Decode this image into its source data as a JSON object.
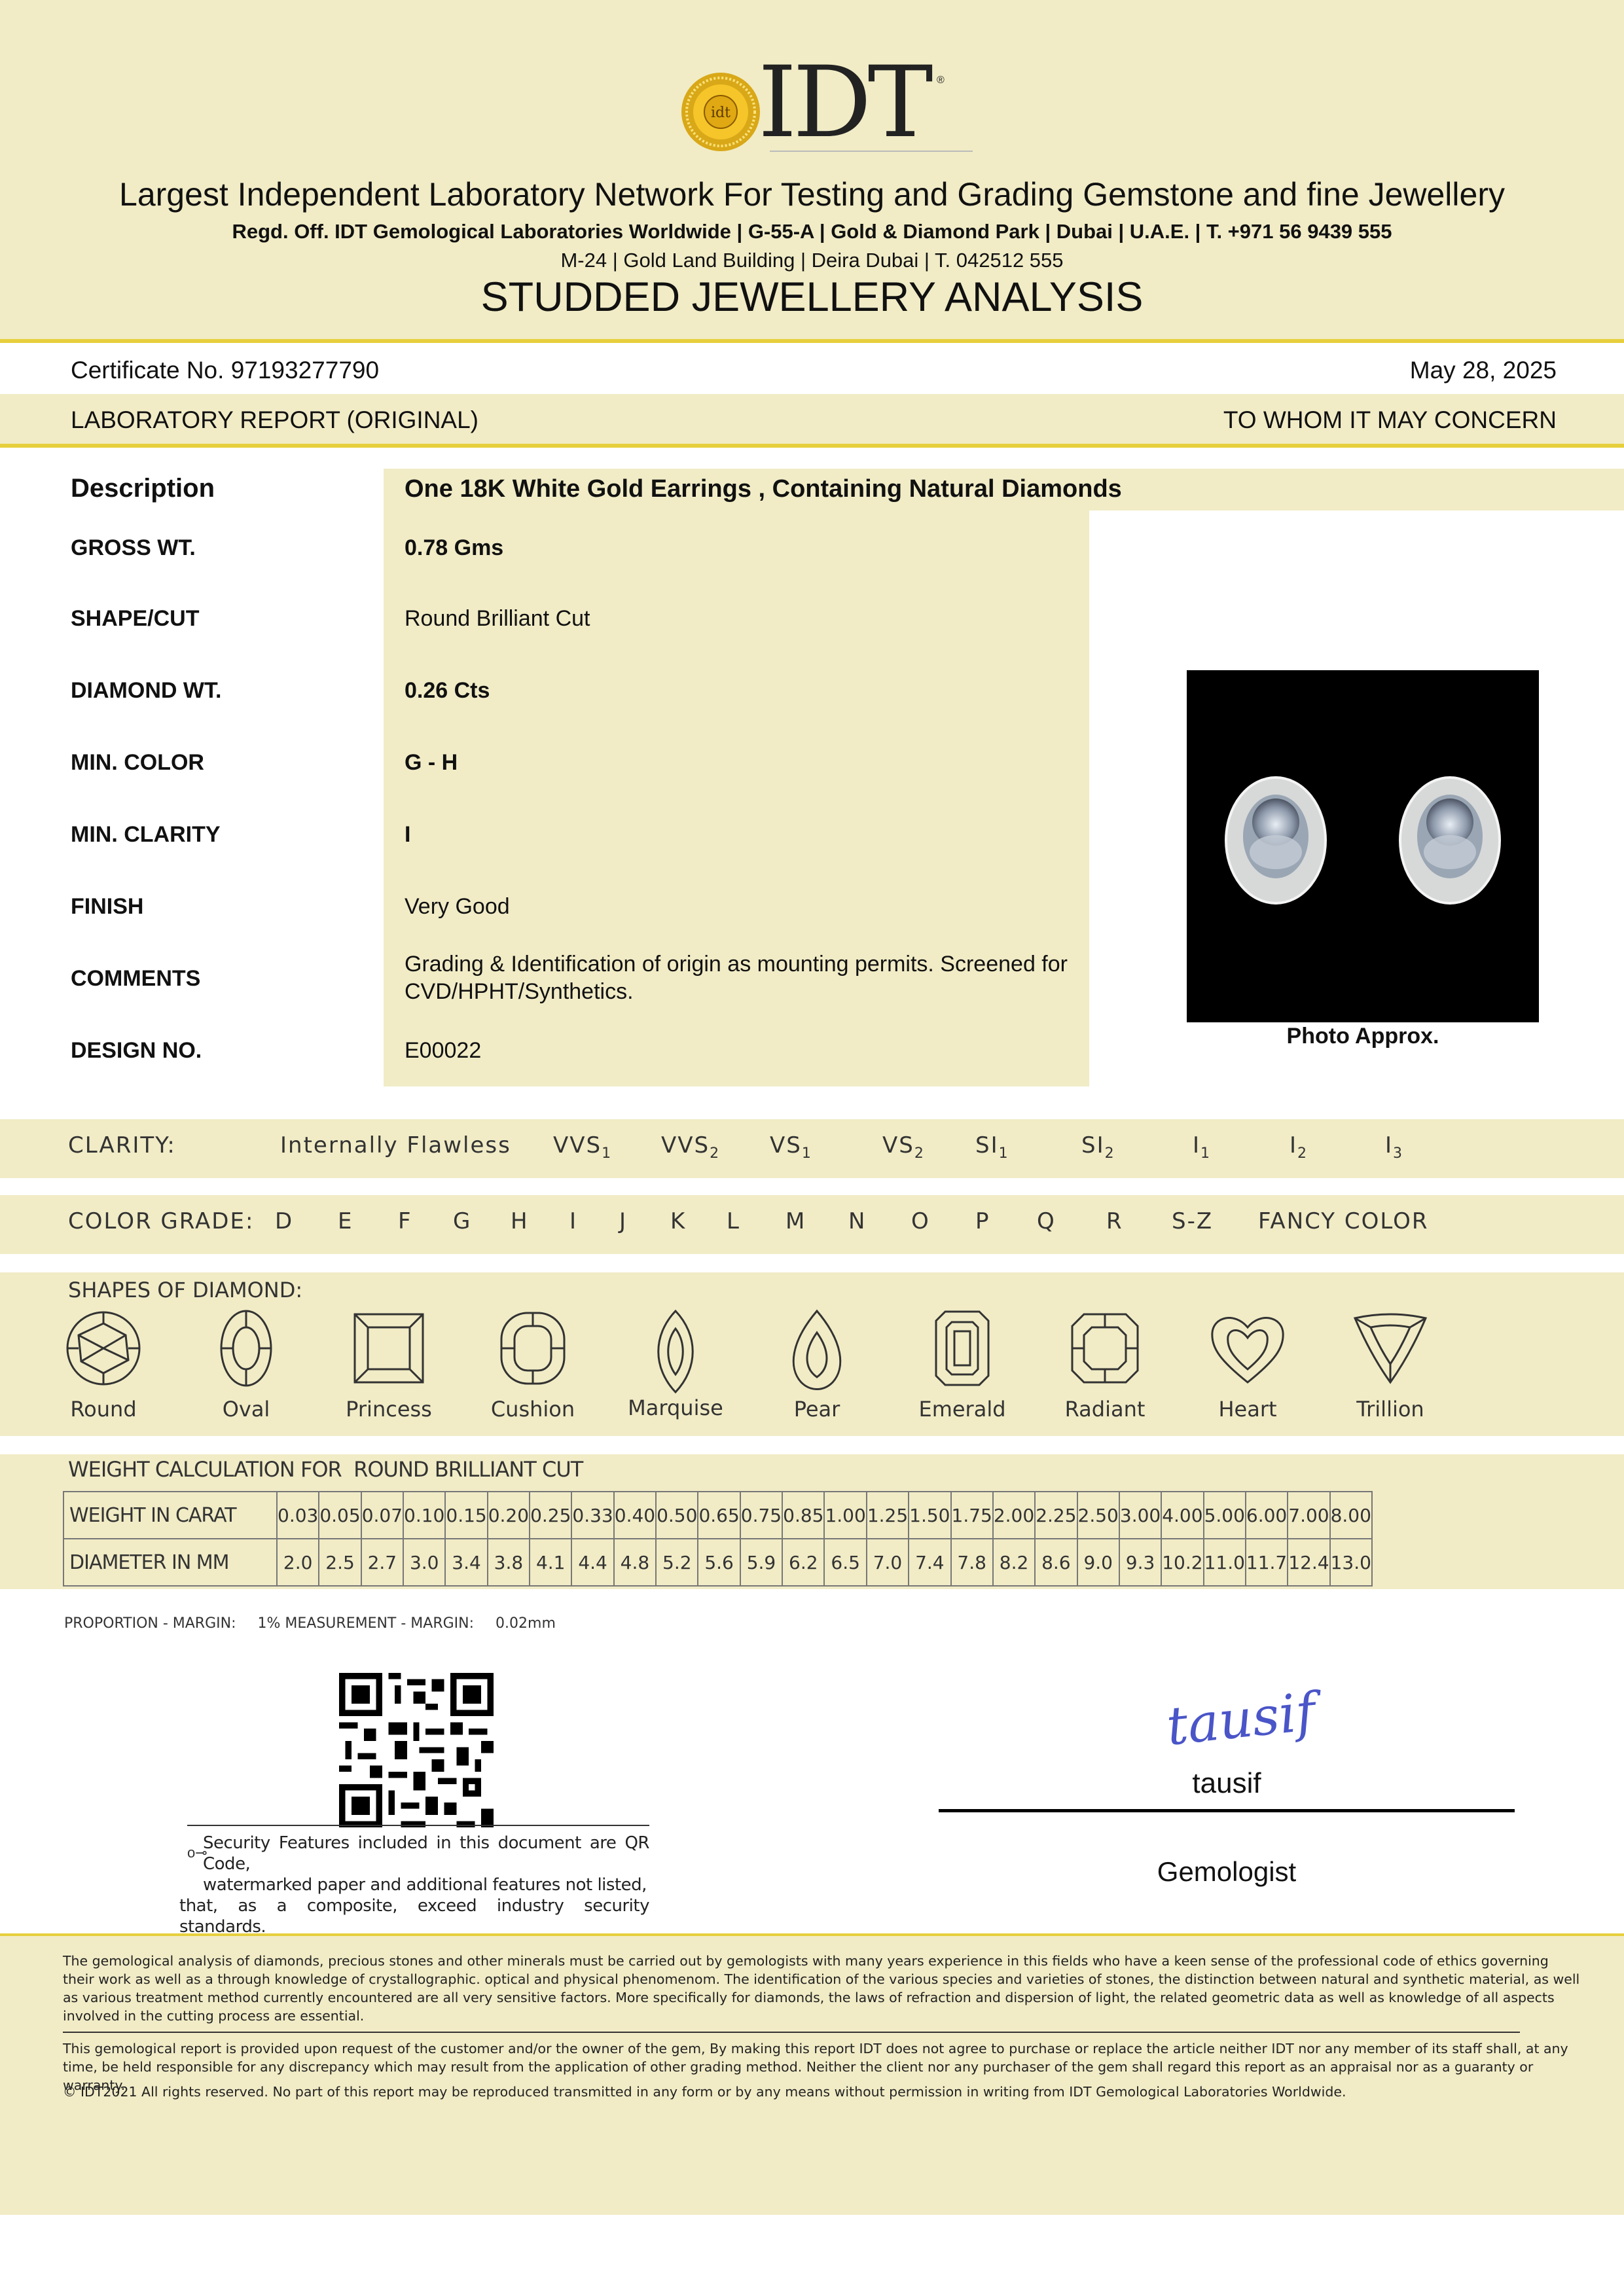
{
  "brand": {
    "name": "IDT",
    "seal_icon": "gold-seal-logo"
  },
  "header": {
    "tagline": "Largest Independent Laboratory Network For Testing and Grading Gemstone and fine Jewellery",
    "reg_office": "Regd. Off. IDT Gemological Laboratories Worldwide | G-55-A | Gold & Diamond Park | Dubai | U.A.E. | T. +971 56 9439 555",
    "branch": "M-24 | Gold Land Building | Deira Dubai | T. 042512 555",
    "title": "STUDDED JEWELLERY ANALYSIS"
  },
  "certificate": {
    "number": "Certificate No. 97193277790",
    "date": "May 28, 2025",
    "report_type": "LABORATORY REPORT (ORIGINAL)",
    "addressee": "TO WHOM IT MAY CONCERN"
  },
  "description": {
    "label": "Description",
    "value": "One 18K White Gold Earrings , Containing Natural Diamonds"
  },
  "fields": [
    {
      "label": "GROSS WT.",
      "value": "0.78 Gms",
      "bold": true
    },
    {
      "label": "SHAPE/CUT",
      "value": "Round Brilliant Cut",
      "bold": false
    },
    {
      "label": "DIAMOND WT.",
      "value": "0.26 Cts",
      "bold": true
    },
    {
      "label": "MIN. COLOR",
      "value": "G - H",
      "bold": true
    },
    {
      "label": "MIN. CLARITY",
      "value": "I",
      "bold": true
    },
    {
      "label": "FINISH",
      "value": "Very Good",
      "bold": false
    },
    {
      "label": "COMMENTS",
      "value": "Grading & Identification of origin as mounting permits. Screened for CVD/HPHT/Synthetics.",
      "bold": false
    },
    {
      "label": "DESIGN NO.",
      "value": "E00022",
      "bold": false
    }
  ],
  "photo": {
    "caption": "Photo Approx."
  },
  "clarity_scale": {
    "label": "CLARITY:",
    "grades": [
      "Internally Flawless",
      "VVS",
      "VVS",
      "VS",
      "VS",
      "SI",
      "SI",
      "I",
      "I",
      "I"
    ],
    "subs": [
      "",
      "1",
      "2",
      "1",
      "2",
      "1",
      "2",
      "1",
      "2",
      "3"
    ]
  },
  "color_scale": {
    "label": "COLOR GRADE:",
    "grades": [
      "D",
      "E",
      "F",
      "G",
      "H",
      "I",
      "J",
      "K",
      "L",
      "M",
      "N",
      "O",
      "P",
      "Q",
      "R",
      "S-Z",
      "FANCY COLOR"
    ]
  },
  "shapes": {
    "title": "SHAPES OF DIAMOND:",
    "items": [
      "Round",
      "Oval",
      "Princess",
      "Cushion",
      "Marquise",
      "Pear",
      "Emerald",
      "Radiant",
      "Heart",
      "Trillion"
    ]
  },
  "weight_calc": {
    "title": "WEIGHT CALCULATION FOR  ROUND BRILLIANT CUT",
    "row1_label": "WEIGHT IN CARAT",
    "row2_label": "DIAMETER IN MM",
    "carats": [
      "0.03",
      "0.05",
      "0.07",
      "0.10",
      "0.15",
      "0.20",
      "0.25",
      "0.33",
      "0.40",
      "0.50",
      "0.65",
      "0.75",
      "0.85",
      "1.00",
      "1.25",
      "1.50",
      "1.75",
      "2.00",
      "2.25",
      "2.50",
      "3.00",
      "4.00",
      "5.00",
      "6.00",
      "7.00",
      "8.00"
    ],
    "diameters": [
      "2.0",
      "2.5",
      "2.7",
      "3.0",
      "3.4",
      "3.8",
      "4.1",
      "4.4",
      "4.8",
      "5.2",
      "5.6",
      "5.9",
      "6.2",
      "6.5",
      "7.0",
      "7.4",
      "7.8",
      "8.2",
      "8.6",
      "9.0",
      "9.3",
      "10.2",
      "11.0",
      "11.7",
      "12.4",
      "13.0"
    ]
  },
  "margin": {
    "proportion_label": "PROPORTION - MARGIN:",
    "proportion_value": "1%",
    "measurement_label": "MEASUREMENT - MARGIN:",
    "measurement_value": "0.02mm"
  },
  "security": {
    "line1": "Security Features included in this document are QR Code,",
    "line2": "watermarked paper and additional features not listed,",
    "line3": "that, as a composite, exceed industry security standards."
  },
  "signature": {
    "script": "tausif",
    "name": "tausif",
    "role": "Gemologist"
  },
  "legal": {
    "para1": "The gemological analysis of diamonds, precious stones and other minerals must be carried out by gemologists with many years experience in this fields who have a keen sense of the professional code of ethics governing their work as well as a through knowledge  of crystallographic. optical and physical phenomenom. The identification of the various species and varieties of stones, the distinction between natural and synthetic material, as well as various treatment method currently encountered are all very sensitive factors. More specifically for diamonds, the laws of refraction and dispersion of light, the related geometric data as well as knowledge of all aspects involved in the cutting process are essential.",
    "para2": "This gemological report is provided upon request of the customer and/or the owner of the gem, By making this report IDT does not agree to purchase or replace the article neither IDT nor any member of its staff shall, at any time, be held responsible for any discrepancy which may result from the application of other grading method. Neither the client nor any purchaser of the gem shall regard this report as an appraisal nor as a guaranty or warranty.",
    "copyright": "© IDT2021 All rights reserved. No part of this report may be reproduced transmitted in any form or by any means without permission in writing from IDT Gemological Laboratories Worldwide."
  },
  "colors": {
    "cream": "#f1ecc6",
    "gold_rule": "#e6cf3d",
    "signature_blue": "#4a55c8"
  }
}
